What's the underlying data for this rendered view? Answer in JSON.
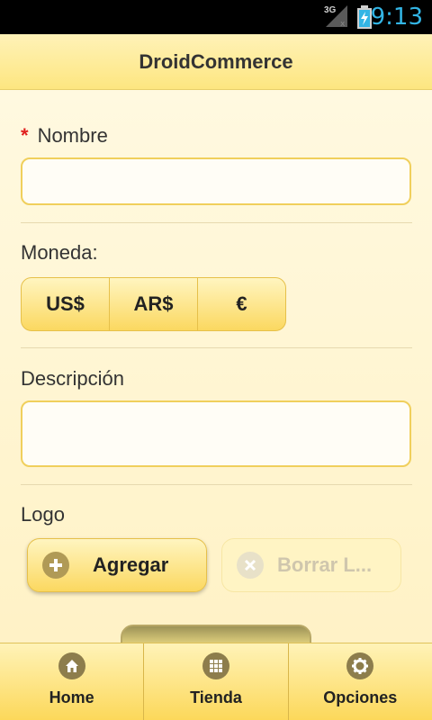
{
  "status_bar": {
    "network": "3G",
    "time": "9:13"
  },
  "header": {
    "title": "DroidCommerce"
  },
  "form": {
    "nombre": {
      "required_mark": "*",
      "label": "Nombre",
      "value": ""
    },
    "moneda": {
      "label": "Moneda:",
      "options": [
        "US$",
        "AR$",
        "€"
      ]
    },
    "descripcion": {
      "label": "Descripción",
      "value": ""
    },
    "logo": {
      "label": "Logo",
      "add_button": "Agregar",
      "delete_button": "Borrar L..."
    }
  },
  "tabs": [
    {
      "label": "Home",
      "icon": "home-icon"
    },
    {
      "label": "Tienda",
      "icon": "grid-icon"
    },
    {
      "label": "Opciones",
      "icon": "gear-icon"
    }
  ],
  "colors": {
    "accent": "#fbd860",
    "status_time": "#33b5e5",
    "required": "#e0201e"
  }
}
